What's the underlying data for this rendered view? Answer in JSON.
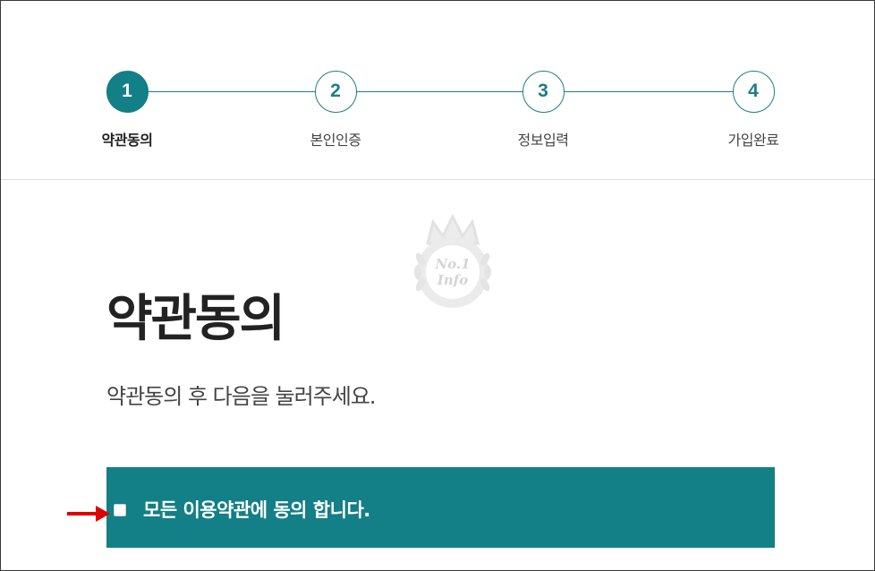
{
  "stepper": {
    "steps": [
      {
        "number": "1",
        "label": "약관동의"
      },
      {
        "number": "2",
        "label": "본인인증"
      },
      {
        "number": "3",
        "label": "정보입력"
      },
      {
        "number": "4",
        "label": "가입완료"
      }
    ],
    "active_step": 1
  },
  "watermark": {
    "text_line1": "No.1",
    "text_line2": "Info"
  },
  "main": {
    "title": "약관동의",
    "subtitle": "약관동의 후 다음을 눌러주세요."
  },
  "agree_all": {
    "label": "모든 이용약관에 동의 합니다.",
    "checked": false
  },
  "colors": {
    "accent": "#137f86",
    "annotation_arrow": "#e00000"
  }
}
